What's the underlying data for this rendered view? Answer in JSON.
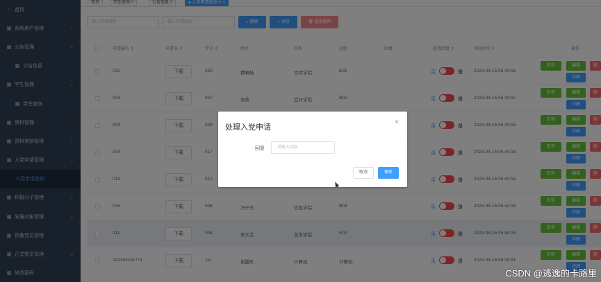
{
  "sidebar": {
    "items": [
      {
        "label": "首页",
        "icon": "home-icon",
        "arrow": false
      },
      {
        "label": "系统用户管理",
        "icon": "grid-icon",
        "arrow": true
      },
      {
        "label": "公告管理",
        "icon": "grid-icon",
        "arrow": true
      },
      {
        "label": "公告信息",
        "icon": "grid-icon",
        "arrow": false,
        "sub": true
      },
      {
        "label": "学生管理",
        "icon": "grid-icon",
        "arrow": true
      },
      {
        "label": "学生查询",
        "icon": "grid-icon",
        "arrow": false,
        "sub": true
      },
      {
        "label": "资料管理",
        "icon": "grid-icon",
        "arrow": true
      },
      {
        "label": "资料类别管理",
        "icon": "grid-icon",
        "arrow": true
      },
      {
        "label": "入党申请管理",
        "icon": "grid-icon",
        "arrow": true
      },
      {
        "label": "入党申请查询",
        "icon": "",
        "arrow": false,
        "active": true
      },
      {
        "label": "积极分子管理",
        "icon": "grid-icon",
        "arrow": true
      },
      {
        "label": "发展对象管理",
        "icon": "grid-icon",
        "arrow": true
      },
      {
        "label": "预备党员管理",
        "icon": "grid-icon",
        "arrow": true
      },
      {
        "label": "正式党员管理",
        "icon": "grid-icon",
        "arrow": true
      },
      {
        "label": "修改密码",
        "icon": "grid-icon",
        "arrow": false
      }
    ]
  },
  "tags": [
    {
      "label": "首页",
      "close": ""
    },
    {
      "label": "学生查询",
      "close": "×"
    },
    {
      "label": "公告信息",
      "close": "×"
    },
    {
      "label": "● 入党申请查询 ⟳ ×",
      "close": "",
      "active": true
    }
  ],
  "filter": {
    "input1_placeholder": "输入申请编号",
    "input2_placeholder": "输入申请理由",
    "search_label": "搜索",
    "add_label": "添加",
    "batch_delete_label": "批量删除"
  },
  "table": {
    "headers": [
      "申请编号",
      "申请书",
      "学号",
      "姓名",
      "院系",
      "班级",
      "回复",
      "是否回复",
      "添加时间",
      "操作"
    ],
    "rows": [
      {
        "id": "032",
        "download": "下载",
        "student_no": "020",
        "name": "穆轶桂",
        "dept": "文传学院",
        "class": "E01",
        "reply_no": "否",
        "reply_yes": "是",
        "time": "2023-04-15 05:44:15"
      },
      {
        "id": "008",
        "download": "下载",
        "student_no": "007",
        "name": "张燕",
        "dept": "会计学院",
        "class": "B02",
        "reply_no": "否",
        "reply_yes": "是",
        "time": "2023-04-15 05:44:15"
      },
      {
        "id": "009",
        "download": "下载",
        "student_no": "003",
        "name": "",
        "dept": "",
        "class": "",
        "reply_no": "否",
        "reply_yes": "是",
        "time": "2023-04-15 05:44:15"
      },
      {
        "id": "004",
        "download": "下载",
        "student_no": "017",
        "name": "",
        "dept": "",
        "class": "",
        "reply_no": "否",
        "reply_yes": "是",
        "time": "2023-04-15 05:44:15"
      },
      {
        "id": "013",
        "download": "下载",
        "student_no": "010",
        "name": "",
        "dept": "",
        "class": "",
        "reply_no": "否",
        "reply_yes": "是",
        "time": "2023-04-15 05:44:15"
      },
      {
        "id": "034",
        "download": "下载",
        "student_no": "006",
        "name": "冯子杰",
        "dept": "信息学院",
        "class": "B03",
        "reply_no": "否",
        "reply_yes": "是",
        "time": "2023-04-15 05:44:15"
      },
      {
        "id": "011",
        "download": "下载",
        "student_no": "004",
        "name": "李大艾",
        "dept": "艺术学院",
        "class": "E02",
        "reply_no": "否",
        "reply_yes": "是",
        "time": "2023-04-15 05:44:15",
        "highlight": true
      },
      {
        "id": "202304161771",
        "download": "下载",
        "student_no": "111",
        "name": "谢霞珍",
        "dept": "计算机",
        "class": "计算机",
        "reply_no": "否",
        "reply_yes": "是",
        "time": "2023-04-16 06:15:51"
      }
    ],
    "ops": {
      "process": "形饰",
      "edit": "编辑",
      "delete": "删",
      "detail": "详细"
    }
  },
  "dialog": {
    "title": "处理入党申请",
    "close": "×",
    "reply_label": "回复",
    "reply_placeholder": "请输入回复",
    "cancel_label": "取消",
    "save_label": "保存"
  },
  "watermark": "CSDN @逃逸的卡路里",
  "colors": {
    "sidebar_bg": "#304156",
    "primary": "#409eff",
    "danger": "#f56c6c",
    "success": "#67c23a",
    "switch_off": "#ff4949"
  }
}
